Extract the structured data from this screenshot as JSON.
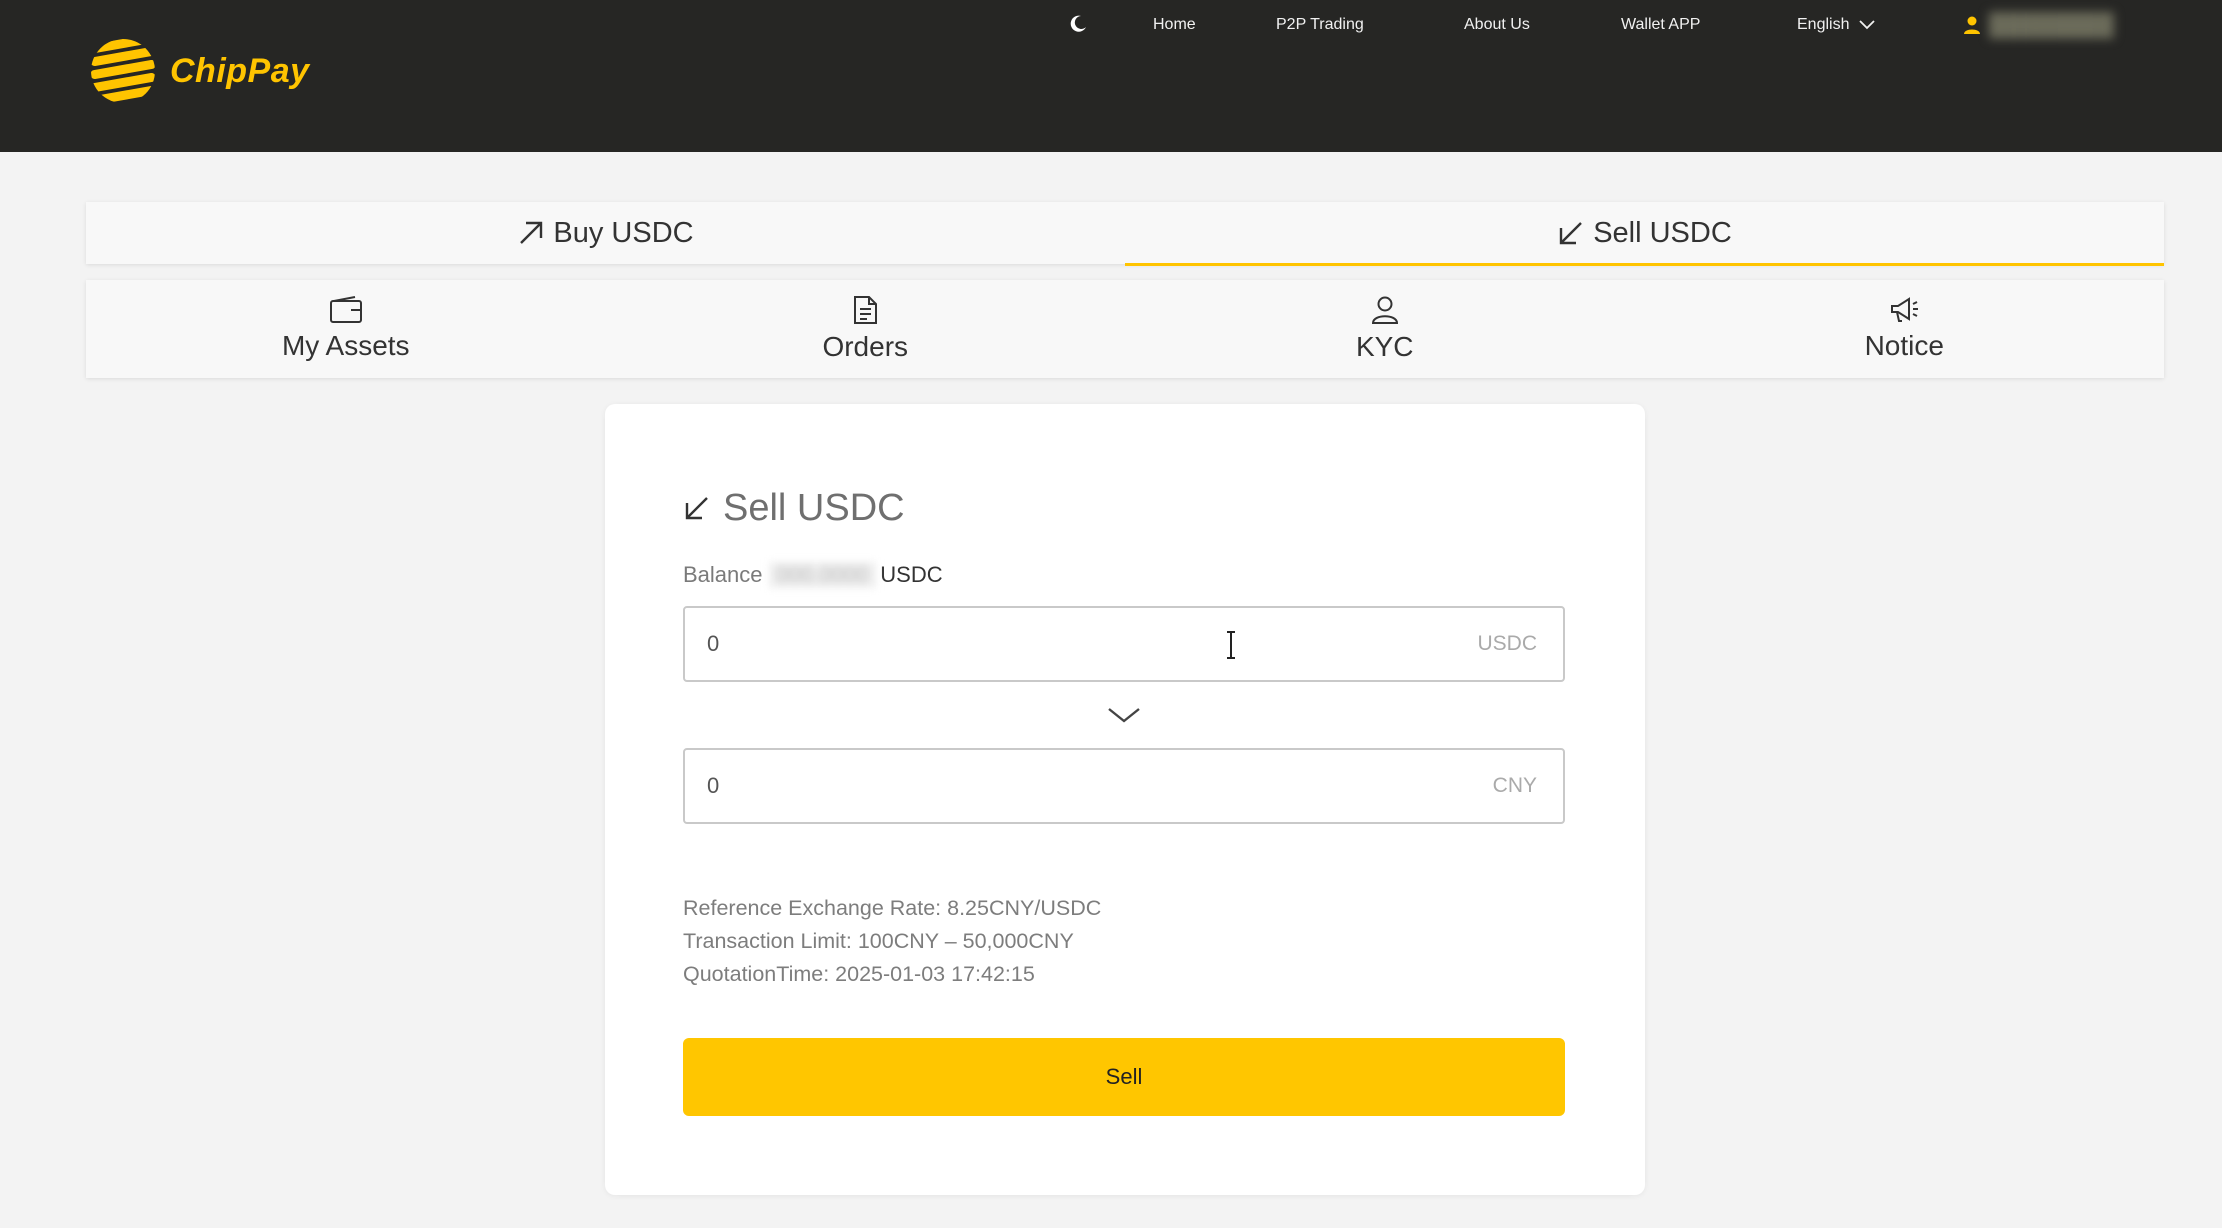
{
  "header": {
    "brand": "ChipPay",
    "nav": {
      "home": "Home",
      "p2p": "P2P Trading",
      "about": "About Us",
      "wallet": "Wallet APP",
      "language": "English"
    }
  },
  "trade_tabs": [
    {
      "label": "Buy USDC",
      "active": false
    },
    {
      "label": "Sell USDC",
      "active": true
    }
  ],
  "section_nav": {
    "assets": "My Assets",
    "orders": "Orders",
    "kyc": "KYC",
    "notice": "Notice"
  },
  "sell_form": {
    "title": "Sell USDC",
    "balance_label": "Balance",
    "balance_unit": "USDC",
    "usdc_value": "0",
    "usdc_unit": "USDC",
    "cny_value": "0",
    "cny_unit": "CNY",
    "rate_text": "Reference Exchange Rate: 8.25CNY/USDC",
    "limit_text": "Transaction Limit: 100CNY – 50,000CNY",
    "quotation_text": "QuotationTime: 2025-01-03 17:42:15",
    "submit_label": "Sell"
  },
  "colors": {
    "header_bg": "#262624",
    "brand_accent": "#ffc400",
    "button_bg": "#ffc600",
    "page_bg": "#f3f3f3"
  },
  "icons": {
    "logo": "chippay-logo-icon",
    "theme": "moon-icon",
    "language": "chevron-down-icon",
    "user": "user-icon",
    "buy": "arrow-up-right-icon",
    "sell": "arrow-down-left-icon",
    "assets": "wallet-icon",
    "orders": "document-icon",
    "kyc": "person-icon",
    "notice": "megaphone-icon",
    "swap": "chevron-down-icon",
    "cursor": "text-cursor-icon"
  }
}
